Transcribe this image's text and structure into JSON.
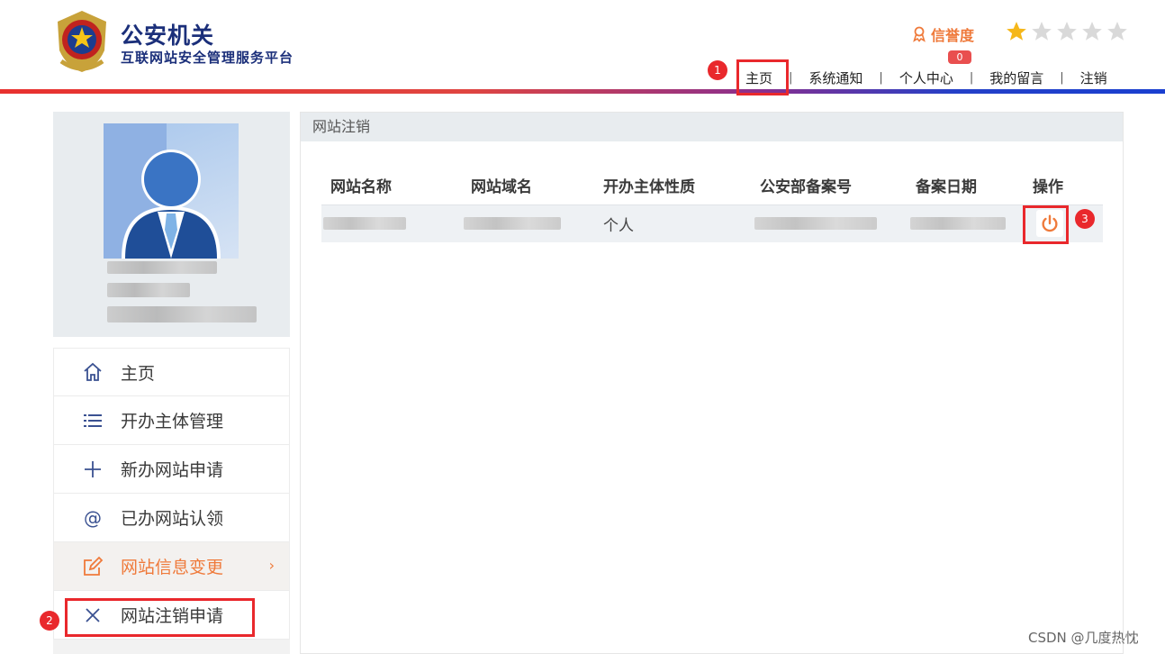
{
  "header": {
    "title": "公安机关",
    "subtitle": "互联网站安全管理服务平台",
    "credit_label": "信誉度",
    "rating": {
      "filled": 1,
      "total": 5
    },
    "notice_count": "0",
    "nav": [
      {
        "label": "主页"
      },
      {
        "label": "系统通知"
      },
      {
        "label": "个人中心"
      },
      {
        "label": "我的留言"
      },
      {
        "label": "注销"
      }
    ],
    "separator": "|"
  },
  "markers": [
    "1",
    "2",
    "3"
  ],
  "sidebar": {
    "items": [
      {
        "label": "主页",
        "icon": "home-icon"
      },
      {
        "label": "开办主体管理",
        "icon": "list-icon"
      },
      {
        "label": "新办网站申请",
        "icon": "plus-icon"
      },
      {
        "label": "已办网站认领",
        "icon": "at-icon"
      },
      {
        "label": "网站信息变更",
        "icon": "edit-icon",
        "active": true
      },
      {
        "label": "网站注销申请",
        "icon": "close-icon"
      }
    ]
  },
  "main": {
    "panel_title": "网站注销",
    "table": {
      "columns": [
        "网站名称",
        "网站域名",
        "开办主体性质",
        "公安部备案号",
        "备案日期",
        "操作"
      ],
      "rows": [
        {
          "site_type": "个人",
          "action_icon": "power-icon"
        }
      ]
    }
  },
  "watermark": "CSDN @几度热忱",
  "colors": {
    "brand_blue": "#1b2f7a",
    "accent_orange": "#ef7a3b",
    "highlight_red": "#e9282c",
    "star_gold": "#f5b71a"
  }
}
